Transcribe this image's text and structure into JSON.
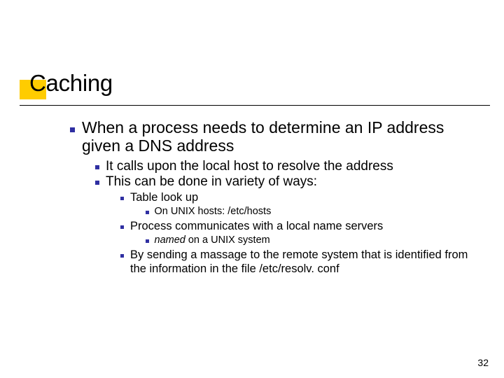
{
  "title": "Caching",
  "bullets": {
    "l1": "When a process needs to determine an IP address given a DNS address",
    "l2a": "It calls upon the local host to resolve the address",
    "l2b": "This can be done in variety of ways:",
    "l3a": "Table look up",
    "l4a": "On UNIX hosts: /etc/hosts",
    "l3b": "Process communicates with a local name servers",
    "l4b_named": "named",
    "l4b_rest": " on a UNIX system",
    "l3c": "By sending a massage to the remote system that is identified from the information in the file /etc/resolv. conf"
  },
  "page_number": "32"
}
